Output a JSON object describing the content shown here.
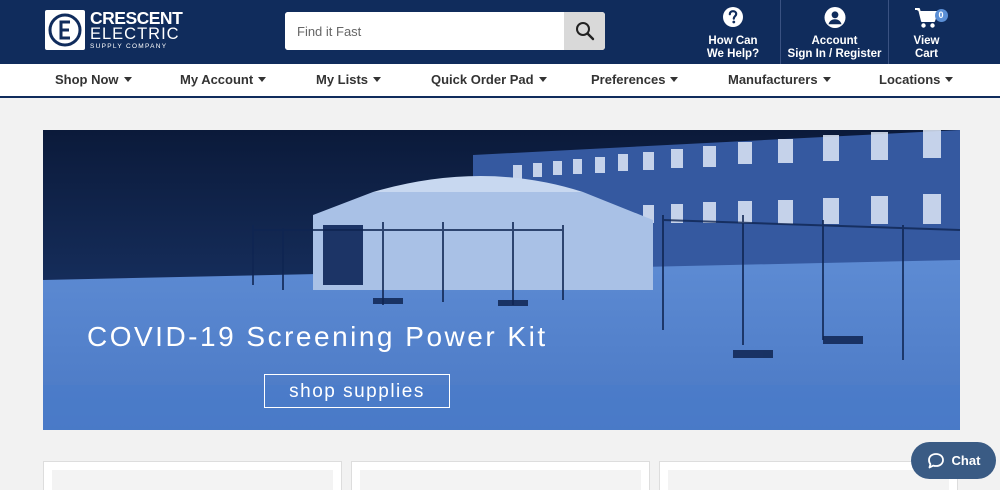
{
  "brand": {
    "name_line1": "CRESCENT",
    "name_line2": "ELECTRIC",
    "tagline": "SUPPLY COMPANY",
    "logo_icon": "ce-monogram-icon"
  },
  "search": {
    "placeholder": "Find it Fast",
    "value": "",
    "icon": "search-icon"
  },
  "header_actions": [
    {
      "line1": "How Can",
      "line2": "We Help?",
      "icon": "help-circle-icon"
    },
    {
      "line1": "Account",
      "line2": "Sign In / Register",
      "icon": "user-circle-icon"
    },
    {
      "line1": "View",
      "line2": "Cart",
      "icon": "cart-icon",
      "badge": "0"
    }
  ],
  "nav": {
    "items": [
      {
        "label": "Shop Now"
      },
      {
        "label": "My Account"
      },
      {
        "label": "My Lists"
      },
      {
        "label": "Quick Order Pad"
      },
      {
        "label": "Preferences"
      },
      {
        "label": "Manufacturers"
      },
      {
        "label": "Locations"
      }
    ]
  },
  "hero": {
    "title": "COVID-19 Screening Power Kit",
    "button_label": "shop supplies"
  },
  "chat": {
    "label": "Chat",
    "icon": "chat-bubble-icon"
  },
  "colors": {
    "header_bg": "#102c5c",
    "hero_tint": "#3d63a8",
    "chat_bg": "#3a5b84",
    "badge": "#5b8fd6"
  }
}
